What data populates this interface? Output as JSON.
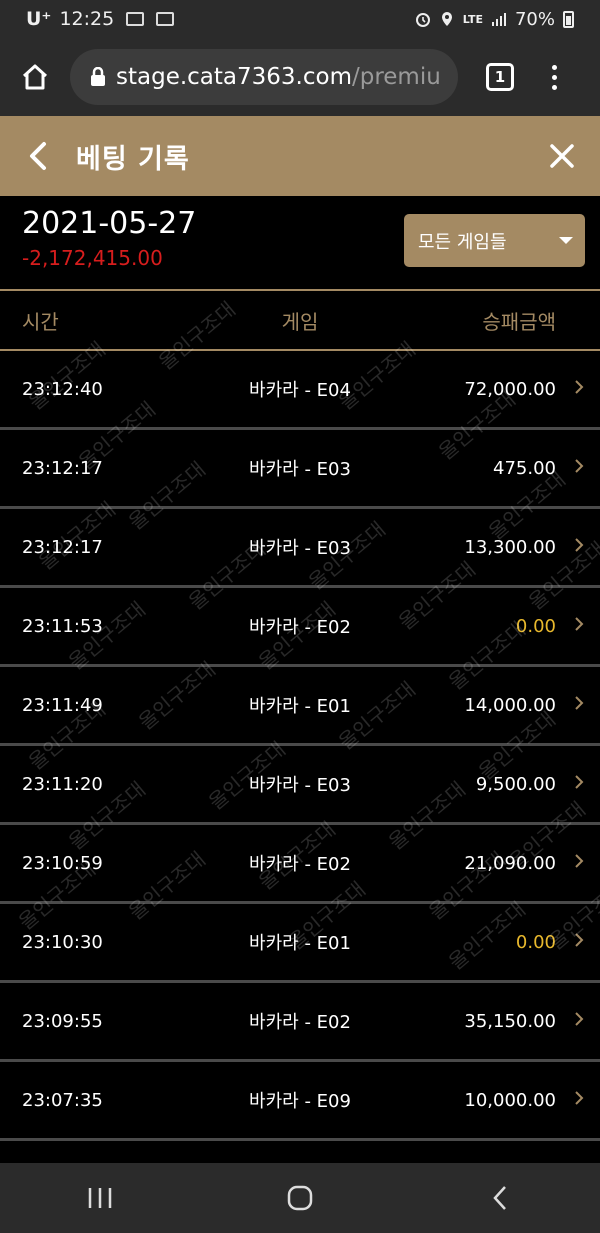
{
  "status": {
    "carrier": "U⁺",
    "time": "12:25",
    "network": "LTE",
    "battery": "70%"
  },
  "browser": {
    "url_host": "stage.cata7363.com",
    "url_path": "/premiu",
    "tab_count": "1"
  },
  "header": {
    "title": "베팅 기록"
  },
  "summary": {
    "date": "2021-05-27",
    "total": "-2,172,415.00",
    "filter_label": "모든 게임들"
  },
  "columns": {
    "time": "시간",
    "game": "게임",
    "amount": "승패금액"
  },
  "rows": [
    {
      "time": "23:12:40",
      "game": "바카라 - E04",
      "amount": "72,000.00"
    },
    {
      "time": "23:12:17",
      "game": "바카라 - E03",
      "amount": "475.00"
    },
    {
      "time": "23:12:17",
      "game": "바카라 - E03",
      "amount": "13,300.00"
    },
    {
      "time": "23:11:53",
      "game": "바카라 - E02",
      "amount": "0.00"
    },
    {
      "time": "23:11:49",
      "game": "바카라 - E01",
      "amount": "14,000.00"
    },
    {
      "time": "23:11:20",
      "game": "바카라 - E03",
      "amount": "9,500.00"
    },
    {
      "time": "23:10:59",
      "game": "바카라 - E02",
      "amount": "21,090.00"
    },
    {
      "time": "23:10:30",
      "game": "바카라 - E01",
      "amount": "0.00"
    },
    {
      "time": "23:09:55",
      "game": "바카라 - E02",
      "amount": "35,150.00"
    },
    {
      "time": "23:07:35",
      "game": "바카라 - E09",
      "amount": "10,000.00"
    }
  ],
  "watermark": "올인구조대",
  "colors": {
    "accent": "#a48a63",
    "negative": "#d71d1d",
    "zero": "#e8b82d"
  }
}
